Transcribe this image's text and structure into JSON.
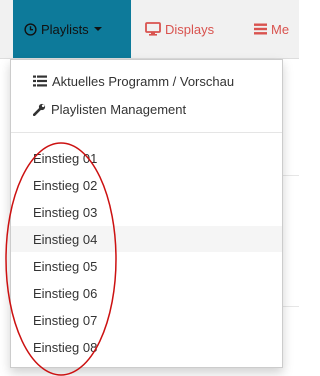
{
  "navbar": {
    "items": [
      {
        "label": "Playlists",
        "icon": "clock-icon",
        "active": true
      },
      {
        "label": "Displays",
        "icon": "monitor-icon"
      },
      {
        "label": "Me",
        "icon": "menu-bars-icon"
      }
    ]
  },
  "dropdown": {
    "top_items": [
      {
        "label": "Aktuelles Programm / Vorschau",
        "icon": "list-icon"
      },
      {
        "label": "Playlisten Management",
        "icon": "wrench-icon"
      }
    ],
    "playlists": [
      "Einstieg 01",
      "Einstieg 02",
      "Einstieg 03",
      "Einstieg 04",
      "Einstieg 05",
      "Einstieg 06",
      "Einstieg 07",
      "Einstieg 08"
    ],
    "hovered_playlist": "Einstieg 04"
  },
  "colors": {
    "active_tab_bg": "#0d7a9a",
    "danger": "#d9534f",
    "annotation": "#cc1111",
    "navbar_bg": "#f1f1f1"
  }
}
